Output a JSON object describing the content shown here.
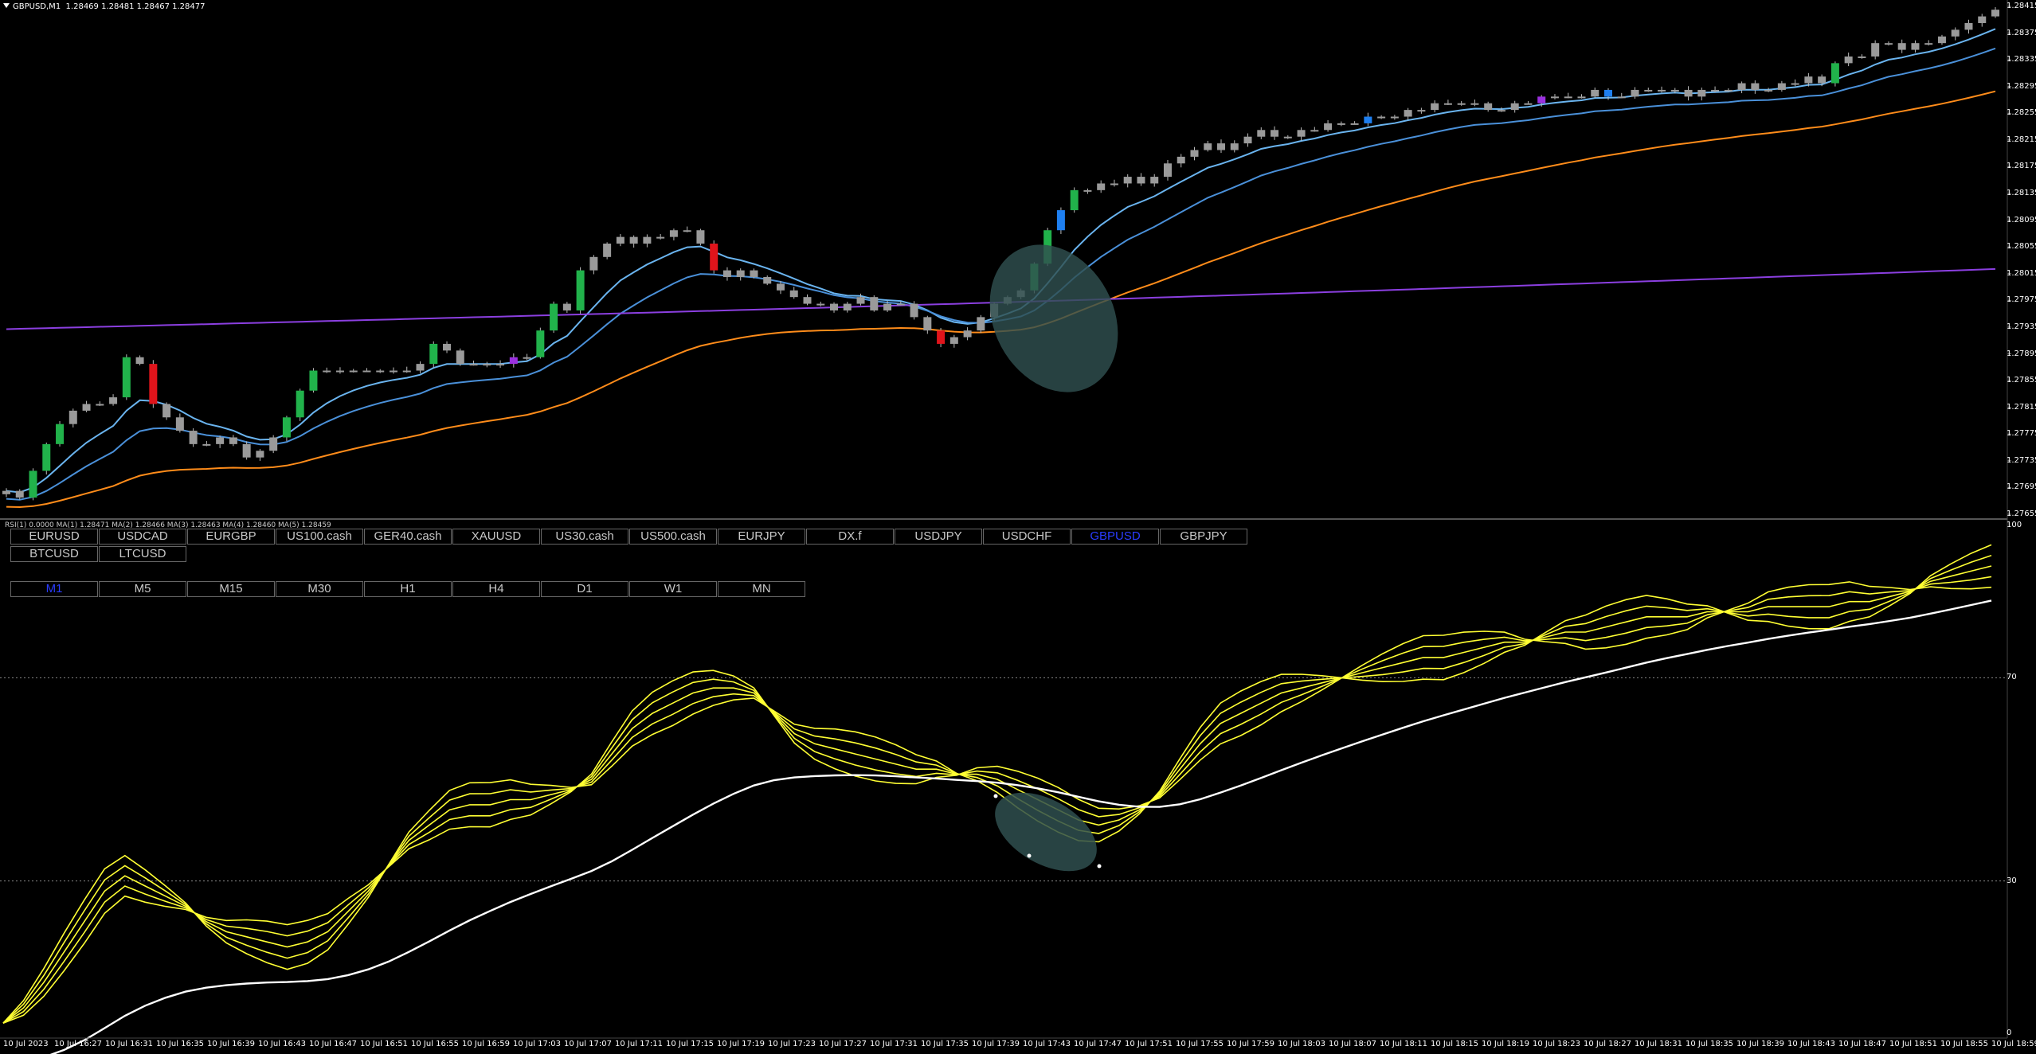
{
  "header": {
    "symbol": "GBPUSD,M1",
    "ohlc": "1.28469 1.28481 1.28467 1.28477"
  },
  "subwindow_header": "RSI(1) 0.0000  MA(1) 1.28471  MA(2) 1.28466  MA(3) 1.28463  MA(4) 1.28460  MA(5) 1.28459",
  "symbol_buttons": [
    {
      "label": "EURUSD",
      "active": false
    },
    {
      "label": "USDCAD",
      "active": false
    },
    {
      "label": "EURGBP",
      "active": false
    },
    {
      "label": "US100.cash",
      "active": false
    },
    {
      "label": "GER40.cash",
      "active": false
    },
    {
      "label": "XAUUSD",
      "active": false
    },
    {
      "label": "US30.cash",
      "active": false
    },
    {
      "label": "US500.cash",
      "active": false
    },
    {
      "label": "EURJPY",
      "active": false
    },
    {
      "label": "DX.f",
      "active": false
    },
    {
      "label": "USDJPY",
      "active": false
    },
    {
      "label": "USDCHF",
      "active": false
    },
    {
      "label": "GBPUSD",
      "active": true
    },
    {
      "label": "GBPJPY",
      "active": false
    },
    {
      "label": "BTCUSD",
      "active": false
    },
    {
      "label": "LTCUSD",
      "active": false
    }
  ],
  "period_buttons": [
    {
      "label": "M1",
      "active": true
    },
    {
      "label": "M5",
      "active": false
    },
    {
      "label": "M15",
      "active": false
    },
    {
      "label": "M30",
      "active": false
    },
    {
      "label": "H1",
      "active": false
    },
    {
      "label": "H4",
      "active": false
    },
    {
      "label": "D1",
      "active": false
    },
    {
      "label": "W1",
      "active": false
    },
    {
      "label": "MN",
      "active": false
    }
  ],
  "price_axis": [
    "1.28415",
    "1.28375",
    "1.28335",
    "1.28295",
    "1.28255",
    "1.28215",
    "1.28175",
    "1.28135",
    "1.28095",
    "1.28055",
    "1.28015",
    "1.27975",
    "1.27935",
    "1.27895",
    "1.27855",
    "1.27815",
    "1.27775",
    "1.27735",
    "1.27695",
    "1.27655"
  ],
  "indicator_axis": [
    "100",
    "70",
    "30",
    "0"
  ],
  "time_axis": [
    "10 Jul 2023",
    "10 Jul 16:27",
    "10 Jul 16:31",
    "10 Jul 16:35",
    "10 Jul 16:39",
    "10 Jul 16:43",
    "10 Jul 16:47",
    "10 Jul 16:51",
    "10 Jul 16:55",
    "10 Jul 16:59",
    "10 Jul 17:03",
    "10 Jul 17:07",
    "10 Jul 17:11",
    "10 Jul 17:15",
    "10 Jul 17:19",
    "10 Jul 17:23",
    "10 Jul 17:27",
    "10 Jul 17:31",
    "10 Jul 17:35",
    "10 Jul 17:39",
    "10 Jul 17:43",
    "10 Jul 17:47",
    "10 Jul 17:51",
    "10 Jul 17:55",
    "10 Jul 17:59",
    "10 Jul 18:03",
    "10 Jul 18:07",
    "10 Jul 18:11",
    "10 Jul 18:15",
    "10 Jul 18:19",
    "10 Jul 18:23",
    "10 Jul 18:27",
    "10 Jul 18:31",
    "10 Jul 18:35",
    "10 Jul 18:39",
    "10 Jul 18:43",
    "10 Jul 18:47",
    "10 Jul 18:51",
    "10 Jul 18:55",
    "10 Jul 18:59"
  ],
  "colors": {
    "background": "#000000",
    "candle_gray": "#9a9a9a",
    "candle_green": "#21b24b",
    "candle_red": "#e0141b",
    "candle_purple": "#9b30e0",
    "candle_blue": "#1e7ff0",
    "ma_fast": "#6ab4ef",
    "ma_slow": "#4a90d9",
    "ma_orange": "#ff8c1a",
    "ma_purple": "#8b3fe0",
    "rsi_yellow": "#ffff33",
    "rsi_white": "#ffffff",
    "highlight": "#2f4f4f"
  },
  "chart_data": {
    "type": "candlestick",
    "symbol": "GBPUSD",
    "timeframe": "M1",
    "ylim": [
      1.27655,
      1.28415
    ],
    "indicator_ylim": [
      0,
      100
    ],
    "indicator_levels": [
      70,
      30
    ],
    "close": [
      1.2769,
      1.2768,
      1.2772,
      1.2776,
      1.2779,
      1.2781,
      1.2782,
      1.2782,
      1.2783,
      1.2789,
      1.2788,
      1.2782,
      1.278,
      1.2778,
      1.2776,
      1.2776,
      1.2777,
      1.2776,
      1.2774,
      1.2775,
      1.2777,
      1.278,
      1.2784,
      1.2787,
      1.2787,
      1.2787,
      1.2787,
      1.2787,
      1.2787,
      1.2787,
      1.2787,
      1.2788,
      1.2791,
      1.279,
      1.2788,
      1.2788,
      1.2788,
      1.2788,
      1.2789,
      1.2789,
      1.2793,
      1.2797,
      1.2796,
      1.2802,
      1.2804,
      1.2806,
      1.2807,
      1.2806,
      1.2807,
      1.2807,
      1.2808,
      1.2808,
      1.2806,
      1.2802,
      1.2801,
      1.2802,
      1.2801,
      1.28,
      1.2799,
      1.2798,
      1.2797,
      1.2797,
      1.2796,
      1.2797,
      1.2798,
      1.2796,
      1.2797,
      1.2797,
      1.2795,
      1.2793,
      1.2791,
      1.2792,
      1.2793,
      1.2795,
      1.2797,
      1.2798,
      1.2799,
      1.2803,
      1.2808,
      1.2811,
      1.2814,
      1.2814,
      1.2815,
      1.2815,
      1.2816,
      1.2815,
      1.2816,
      1.2818,
      1.2819,
      1.282,
      1.2821,
      1.282,
      1.2821,
      1.2822,
      1.2823,
      1.2822,
      1.2822,
      1.2823,
      1.2823,
      1.2824,
      1.2824,
      1.2824,
      1.2825,
      1.2825,
      1.2825,
      1.2826,
      1.2826,
      1.2827,
      1.2827,
      1.2827,
      1.2827,
      1.2826,
      1.2826,
      1.2827,
      1.2827,
      1.2828,
      1.2828,
      1.2828,
      1.2828,
      1.2829,
      1.2828,
      1.2828,
      1.2829,
      1.2829,
      1.2829,
      1.2829,
      1.2828,
      1.2829,
      1.2829,
      1.2829,
      1.283,
      1.2829,
      1.2829,
      1.283,
      1.283,
      1.2831,
      1.283,
      1.2833,
      1.2834,
      1.2834,
      1.2836,
      1.2836,
      1.2835,
      1.2836,
      1.2836,
      1.2837,
      1.2838,
      1.2839,
      1.284,
      1.2841
    ],
    "rsi": [
      2,
      5,
      10,
      16,
      22,
      28,
      31,
      29,
      27,
      25,
      22,
      20,
      19,
      18,
      17,
      18,
      20,
      24,
      28,
      33,
      38,
      41,
      44,
      45,
      45,
      46,
      46,
      47,
      48,
      50,
      55,
      60,
      63,
      65,
      67,
      68,
      68,
      67,
      63,
      59,
      57,
      56,
      55,
      54,
      53,
      52,
      52,
      51,
      51,
      50,
      48,
      46,
      44,
      42,
      41,
      42,
      44,
      47,
      52,
      57,
      61,
      63,
      65,
      67,
      68,
      69,
      70,
      71,
      72,
      73,
      74,
      74,
      75,
      76,
      77,
      77,
      78,
      79,
      79,
      80,
      81,
      82,
      82,
      82,
      83,
      83,
      83,
      84,
      84,
      84,
      84,
      85,
      85,
      86,
      87,
      89,
      90,
      91,
      92
    ]
  }
}
